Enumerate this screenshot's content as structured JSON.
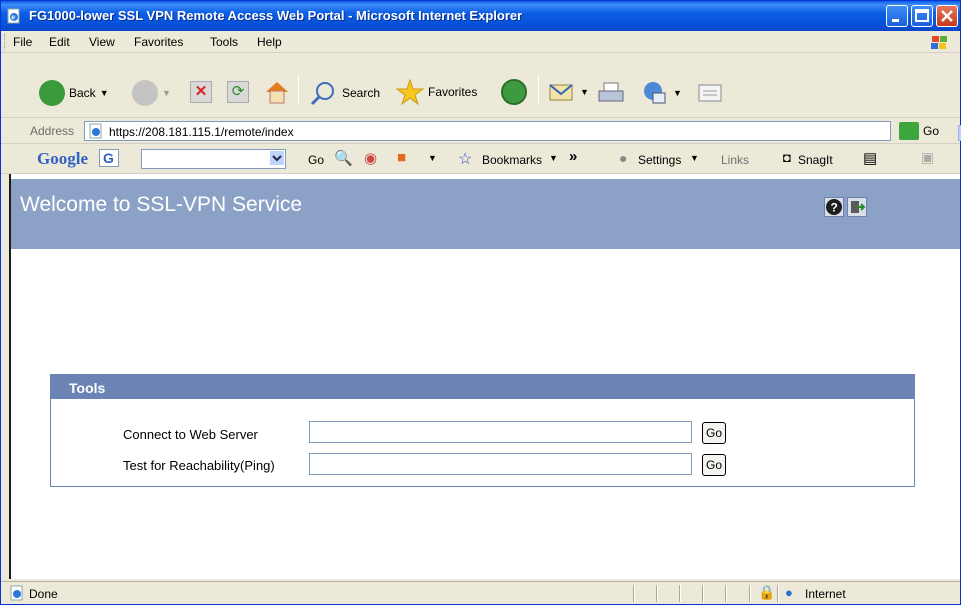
{
  "window": {
    "title": "FG1000-lower SSL VPN Remote Access Web Portal - Microsoft Internet Explorer"
  },
  "menu": [
    "File",
    "Edit",
    "View",
    "Favorites",
    "Tools",
    "Help"
  ],
  "toolbar": {
    "back": "Back",
    "search": "Search",
    "favorites": "Favorites"
  },
  "address": {
    "label": "Address",
    "url": "https://208.181.115.1/remote/index",
    "go": "Go"
  },
  "google_bar": {
    "logo": "Google",
    "go": "Go",
    "bookmarks": "Bookmarks",
    "more": "»",
    "settings": "Settings",
    "links": "Links",
    "snagit": "SnagIt"
  },
  "page": {
    "title": "Welcome to SSL-VPN Service",
    "tools": {
      "title": "Tools",
      "rows": [
        {
          "label": "Connect to Web Server",
          "value": "",
          "button": "Go"
        },
        {
          "label": "Test for Reachability(Ping)",
          "value": "",
          "button": "Go"
        }
      ]
    }
  },
  "status": {
    "text": "Done",
    "zone": "Internet"
  }
}
